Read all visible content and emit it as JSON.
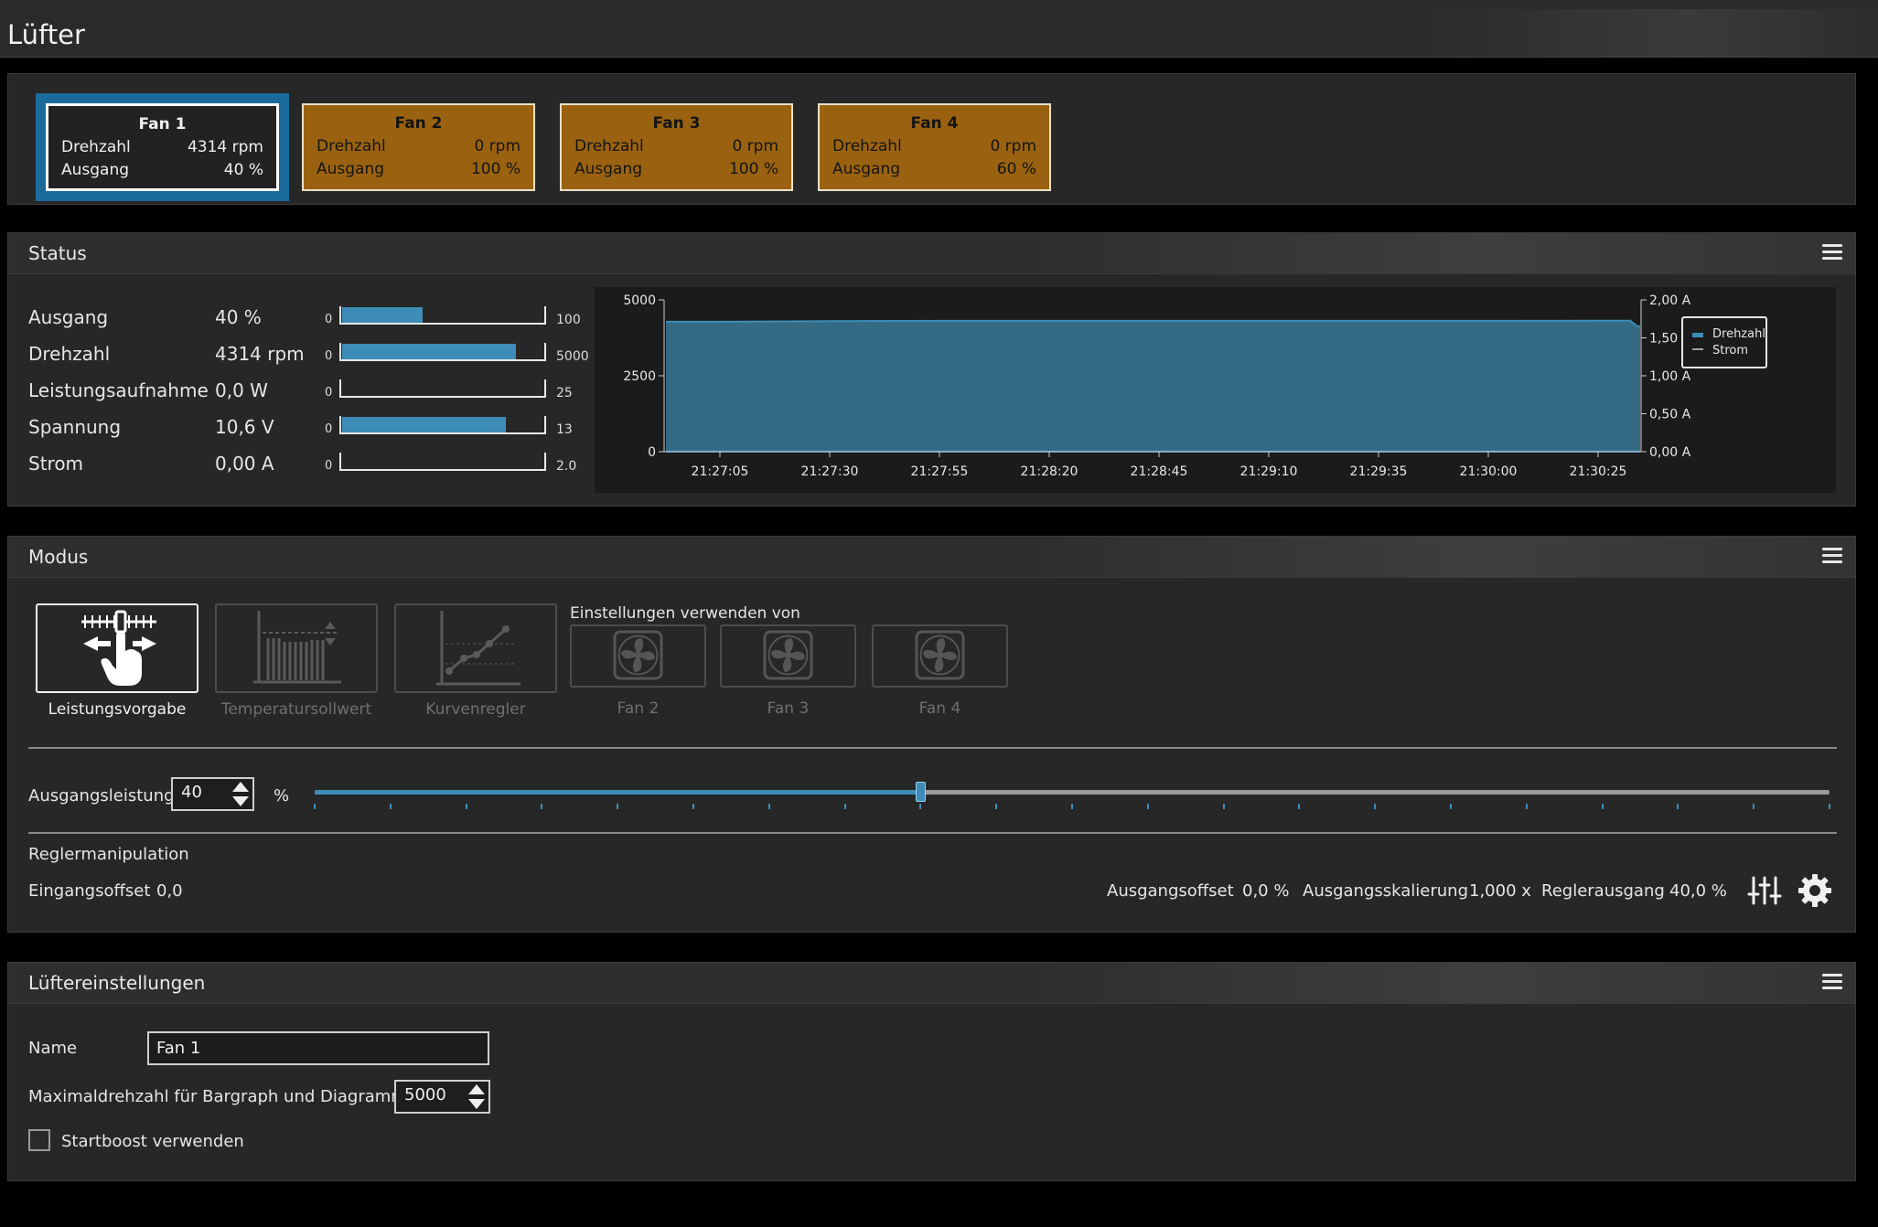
{
  "window": {
    "title": "Lüfter"
  },
  "fans": [
    {
      "name": "Fan 1",
      "rpm_label": "Drehzahl",
      "rpm": "4314 rpm",
      "out_label": "Ausgang",
      "out": "40 %",
      "selected": true
    },
    {
      "name": "Fan 2",
      "rpm_label": "Drehzahl",
      "rpm": "0 rpm",
      "out_label": "Ausgang",
      "out": "100 %",
      "selected": false
    },
    {
      "name": "Fan 3",
      "rpm_label": "Drehzahl",
      "rpm": "0 rpm",
      "out_label": "Ausgang",
      "out": "100 %",
      "selected": false
    },
    {
      "name": "Fan 4",
      "rpm_label": "Drehzahl",
      "rpm": "0 rpm",
      "out_label": "Ausgang",
      "out": "60 %",
      "selected": false
    }
  ],
  "status": {
    "title": "Status",
    "rows": [
      {
        "label": "Ausgang",
        "value": "40 %",
        "min": "0",
        "max": "100",
        "level": 0.4
      },
      {
        "label": "Drehzahl",
        "value": "4314 rpm",
        "min": "0",
        "max": "5000",
        "level": 0.8628
      },
      {
        "label": "Leistungsaufnahme",
        "value": "0,0 W",
        "min": "0",
        "max": "25",
        "level": 0
      },
      {
        "label": "Spannung",
        "value": "10,6 V",
        "min": "0",
        "max": "13",
        "level": 0.8154
      },
      {
        "label": "Strom",
        "value": "0,00 A",
        "min": "0",
        "max": "2.0",
        "level": 0
      }
    ],
    "chart_data": {
      "type": "area",
      "x": [
        "21:27:05",
        "21:27:30",
        "21:27:55",
        "21:28:20",
        "21:28:45",
        "21:29:10",
        "21:29:35",
        "21:30:00",
        "21:30:25"
      ],
      "series": [
        {
          "name": "Drehzahl",
          "axis": "left",
          "values": [
            4280,
            4300,
            4310,
            4310,
            4310,
            4310,
            4310,
            4310,
            4314
          ]
        },
        {
          "name": "Strom",
          "axis": "right",
          "values": [
            0,
            0,
            0,
            0,
            0,
            0,
            0,
            0,
            0
          ]
        }
      ],
      "y_left_ticks": [
        "0",
        "2500",
        "5000"
      ],
      "y_left_range": [
        0,
        5000
      ],
      "y_right_ticks": [
        "0,00 A",
        "0,50 A",
        "1,00 A",
        "1,50 A",
        "2,00 A"
      ],
      "y_right_range": [
        0,
        2
      ],
      "legend": "right",
      "series_color": "#3d8db8",
      "area_color": "#356a84"
    }
  },
  "modus": {
    "title": "Modus",
    "modes": [
      {
        "label": "Leistungsvorgabe",
        "icon": "manual-slider-icon",
        "active": true
      },
      {
        "label": "Temperatursollwert",
        "icon": "temperature-setpoint-icon",
        "active": false
      },
      {
        "label": "Kurvenregler",
        "icon": "curve-controller-icon",
        "active": false
      }
    ],
    "use_settings_label": "Einstellungen verwenden von",
    "use_settings_fans": [
      "Fan 2",
      "Fan 3",
      "Fan 4"
    ],
    "output_label": "Ausgangsleistung",
    "output_value": "40",
    "output_unit": "%",
    "slider_level": 0.4,
    "regler_title": "Reglermanipulation",
    "input_offset_label": "Eingangsoffset",
    "input_offset_value": "0,0",
    "output_offset_label": "Ausgangsoffset",
    "output_offset_value": "0,0 %",
    "output_scale_label": "Ausgangsskalierung",
    "output_scale_value": "1,000 x",
    "regler_output_label": "Reglerausgang",
    "regler_output_value": "40,0 %"
  },
  "settings": {
    "title": "Lüftereinstellungen",
    "name_label": "Name",
    "name_value": "Fan 1",
    "max_rpm_label": "Maximaldrehzahl für Bargraph und Diagramm",
    "max_rpm_value": "5000",
    "startboost_label": "Startboost verwenden",
    "startboost_checked": false
  },
  "colors": {
    "accent": "#3d8db8",
    "selected_fan": "#1b6b9a",
    "inactive_fan": "#9a6210"
  }
}
